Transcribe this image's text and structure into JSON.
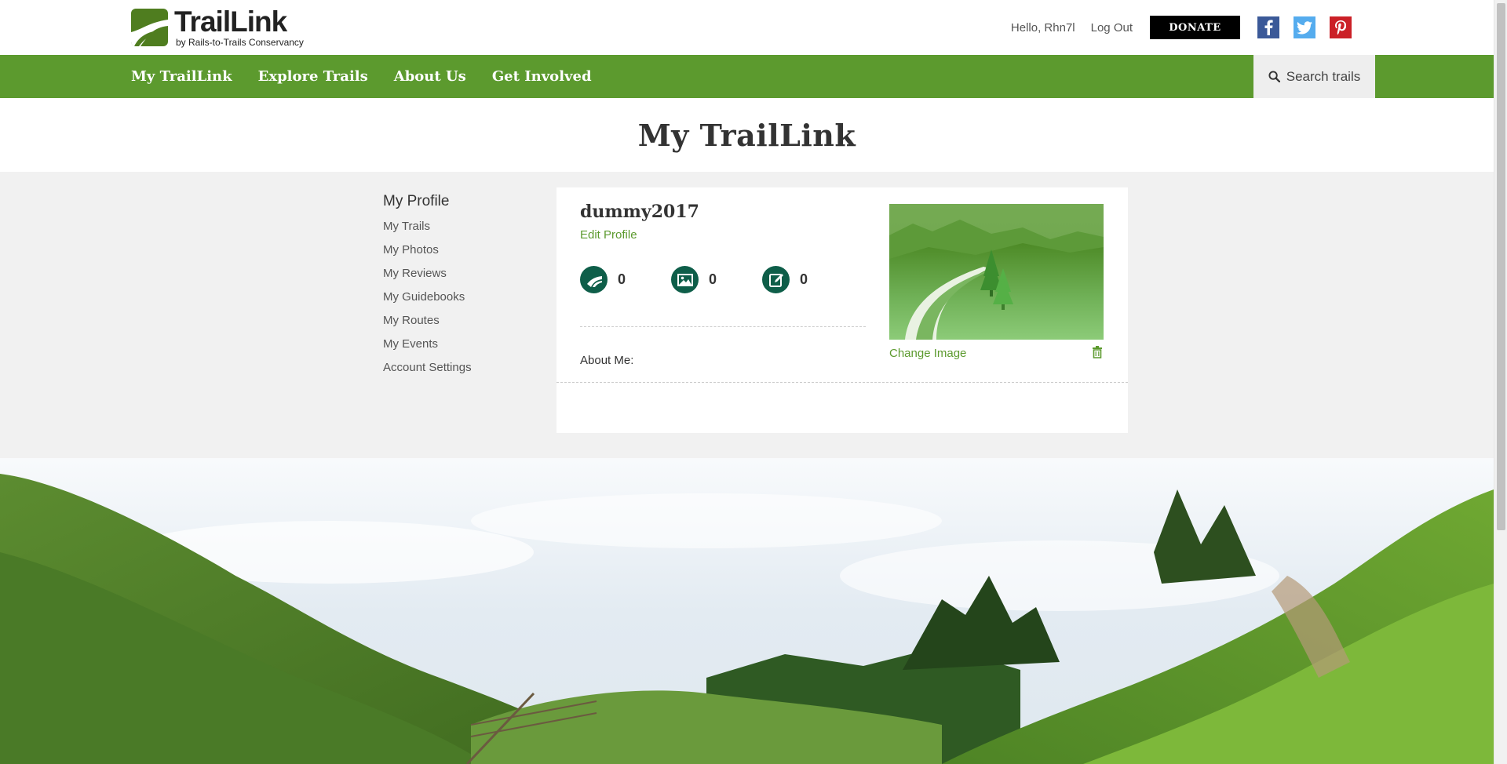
{
  "header": {
    "logo_title": "TrailLink",
    "logo_subtitle": "by Rails-to-Trails Conservancy",
    "greeting": "Hello, Rhn7l",
    "logout_label": "Log Out",
    "donate_label": "DONATE",
    "social": [
      {
        "name": "facebook-icon",
        "glyph": "f",
        "color": "#3b5998"
      },
      {
        "name": "twitter-icon",
        "glyph": "t",
        "color": "#55acee"
      },
      {
        "name": "pinterest-icon",
        "glyph": "p",
        "color": "#cb2027"
      }
    ]
  },
  "nav": {
    "items": [
      {
        "label": "My TrailLink"
      },
      {
        "label": "Explore Trails"
      },
      {
        "label": "About Us"
      },
      {
        "label": "Get Involved"
      }
    ],
    "search_label": "Search trails"
  },
  "page": {
    "title": "My TrailLink"
  },
  "sidebar": {
    "heading": "My Profile",
    "items": [
      {
        "label": "My Trails"
      },
      {
        "label": "My Photos"
      },
      {
        "label": "My Reviews"
      },
      {
        "label": "My Guidebooks"
      },
      {
        "label": "My Routes"
      },
      {
        "label": "My Events"
      },
      {
        "label": "Account Settings"
      }
    ]
  },
  "profile": {
    "username": "dummy2017",
    "edit_label": "Edit Profile",
    "stats": [
      {
        "icon": "trail-icon",
        "count": "0"
      },
      {
        "icon": "photo-icon",
        "count": "0"
      },
      {
        "icon": "review-icon",
        "count": "0"
      }
    ],
    "about_label": "About Me:",
    "change_image_label": "Change Image"
  },
  "colors": {
    "brand_green": "#5c9a2e",
    "stat_icon_bg": "#0e5e49",
    "donate_bg": "#000000"
  }
}
